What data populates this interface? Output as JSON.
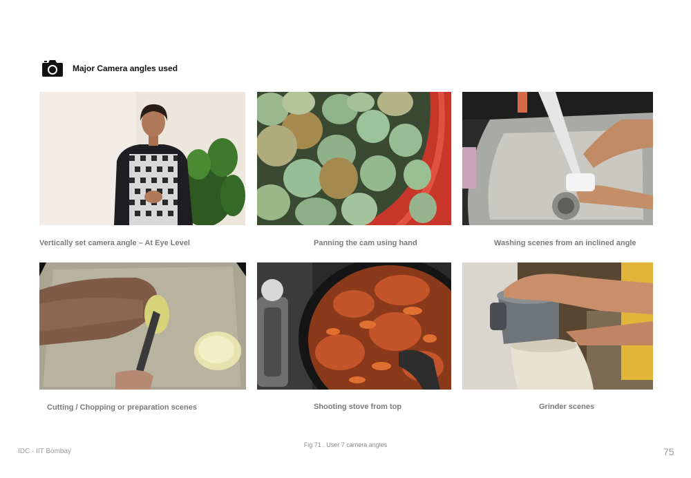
{
  "header": {
    "title": "Major Camera angles used",
    "icon": "camera-icon"
  },
  "photos": [
    {
      "caption": "Vertically set camera angle – At Eye Level",
      "subject": "woman-in-apron-photo"
    },
    {
      "caption": "Panning the cam using hand",
      "subject": "raw-mangoes-basket-photo"
    },
    {
      "caption": "Washing scenes from an inclined angle",
      "subject": "washing-sink-photo"
    },
    {
      "caption": "Cutting / Chopping or preparation scenes",
      "subject": "chopping-board-photo"
    },
    {
      "caption": "Shooting stove from top",
      "subject": "stove-pan-photo"
    },
    {
      "caption": "Grinder scenes",
      "subject": "grinder-photo"
    }
  ],
  "figure_caption": "Fig 71 . User 7 camera angles",
  "footer": {
    "institution": "IDC - IIT Bombay",
    "page_number": "75"
  }
}
